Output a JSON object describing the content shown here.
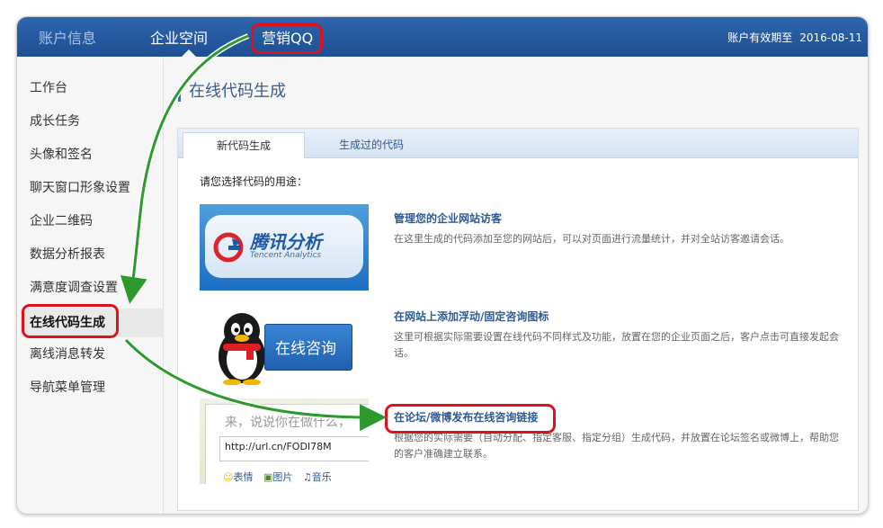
{
  "topbar": {
    "nav": [
      "账户信息",
      "企业空间",
      "营销QQ"
    ],
    "expiry_label": "账户有效期至",
    "expiry_date": "2016-08-11"
  },
  "sidebar": {
    "items": [
      "工作台",
      "成长任务",
      "头像和签名",
      "聊天窗口形象设置",
      "企业二维码",
      "数据分析报表",
      "满意度调查设置",
      "在线代码生成",
      "离线消息转发",
      "导航菜单管理"
    ]
  },
  "page": {
    "title": "在线代码生成",
    "tabs": [
      "新代码生成",
      "生成过的代码"
    ],
    "prompt": "请您选择代码的用途："
  },
  "options": [
    {
      "title": "管理您的企业网站访客",
      "desc": "在这里生成的代码添加至您的网站后，可以对页面进行流量统计，并对全站访客邀请会话。",
      "thumb_text": "腾讯分析",
      "thumb_sub": "Tencent Analytics"
    },
    {
      "title": "在网站上添加浮动/固定咨询图标",
      "desc": "这里可根据实际需要设置在线代码不同样式及功能，放置在您的企业页面之后，客户点击可直接发起会话。",
      "thumb_text": "在线咨询"
    },
    {
      "title": "在论坛/微博发布在线咨询链接",
      "desc": "根据您的实际需要（自动分配、指定客服、指定分组）生成代码，并放置在论坛签名或微博上，帮助您的客户准确建立联系。",
      "thumb_placeholder": "来，说说你在做什么，",
      "thumb_url": "http://url.cn/FODI78M",
      "thumb_tools": [
        "表情",
        "图片",
        "音乐"
      ]
    }
  ],
  "colors": {
    "topbar": "#1e4f93",
    "link": "#2f5a92",
    "annotation": "#e0101c",
    "arrow": "#2e9a2e"
  }
}
